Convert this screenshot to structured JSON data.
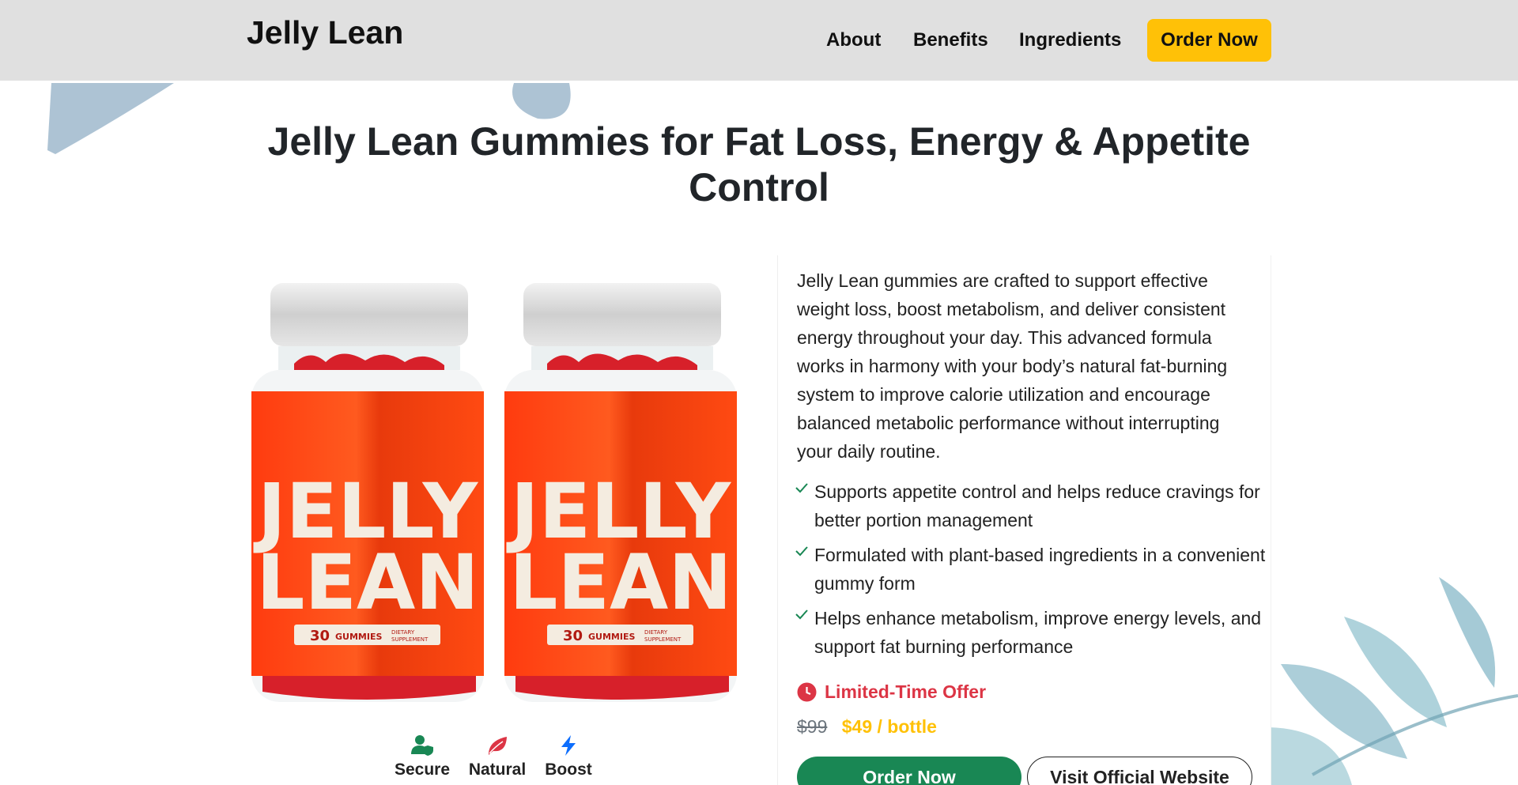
{
  "header": {
    "brand": "Jelly Lean",
    "nav": [
      {
        "label": "About"
      },
      {
        "label": "Benefits"
      },
      {
        "label": "Ingredients"
      }
    ],
    "cta_label": "Order Now"
  },
  "hero": {
    "title": "Jelly Lean Gummies for Fat Loss, Energy & Appetite Control"
  },
  "product": {
    "jar_brand_line1": "JELLY",
    "jar_brand_line2": "LEAN",
    "jar_count": "30",
    "jar_count_label": "GUMMIES",
    "jar_tag_line1": "DIETARY",
    "jar_tag_line2": "SUPPLEMENT"
  },
  "badges": [
    {
      "label": "Secure",
      "icon": "user-shield-icon",
      "color": "#198754"
    },
    {
      "label": "Natural",
      "icon": "leaf-icon",
      "color": "#dc3545"
    },
    {
      "label": "Boost",
      "icon": "bolt-icon",
      "color": "#0d6efd"
    }
  ],
  "info": {
    "description": "Jelly Lean gummies are crafted to support effective weight loss, boost metabolism, and deliver consistent energy throughout your day. This advanced formula works in harmony with your body’s natural fat-burning system to improve calorie utilization and encourage balanced metabolic performance without interrupting your daily routine.",
    "benefits": [
      "Supports appetite control and helps reduce cravings for better portion management",
      "Formulated with plant-based ingredients in a convenient gummy form",
      "Helps enhance metabolism, improve energy levels, and support fat burning performance"
    ],
    "offer_label": "Limited-Time Offer",
    "price_old": "$99",
    "price_new": "$49 / bottle",
    "order_button": "Order Now",
    "website_button": "Visit Official Website"
  },
  "colors": {
    "accent": "#ffc107",
    "success": "#198754",
    "danger": "#dc3545",
    "header_bg": "#e0e0e0"
  }
}
